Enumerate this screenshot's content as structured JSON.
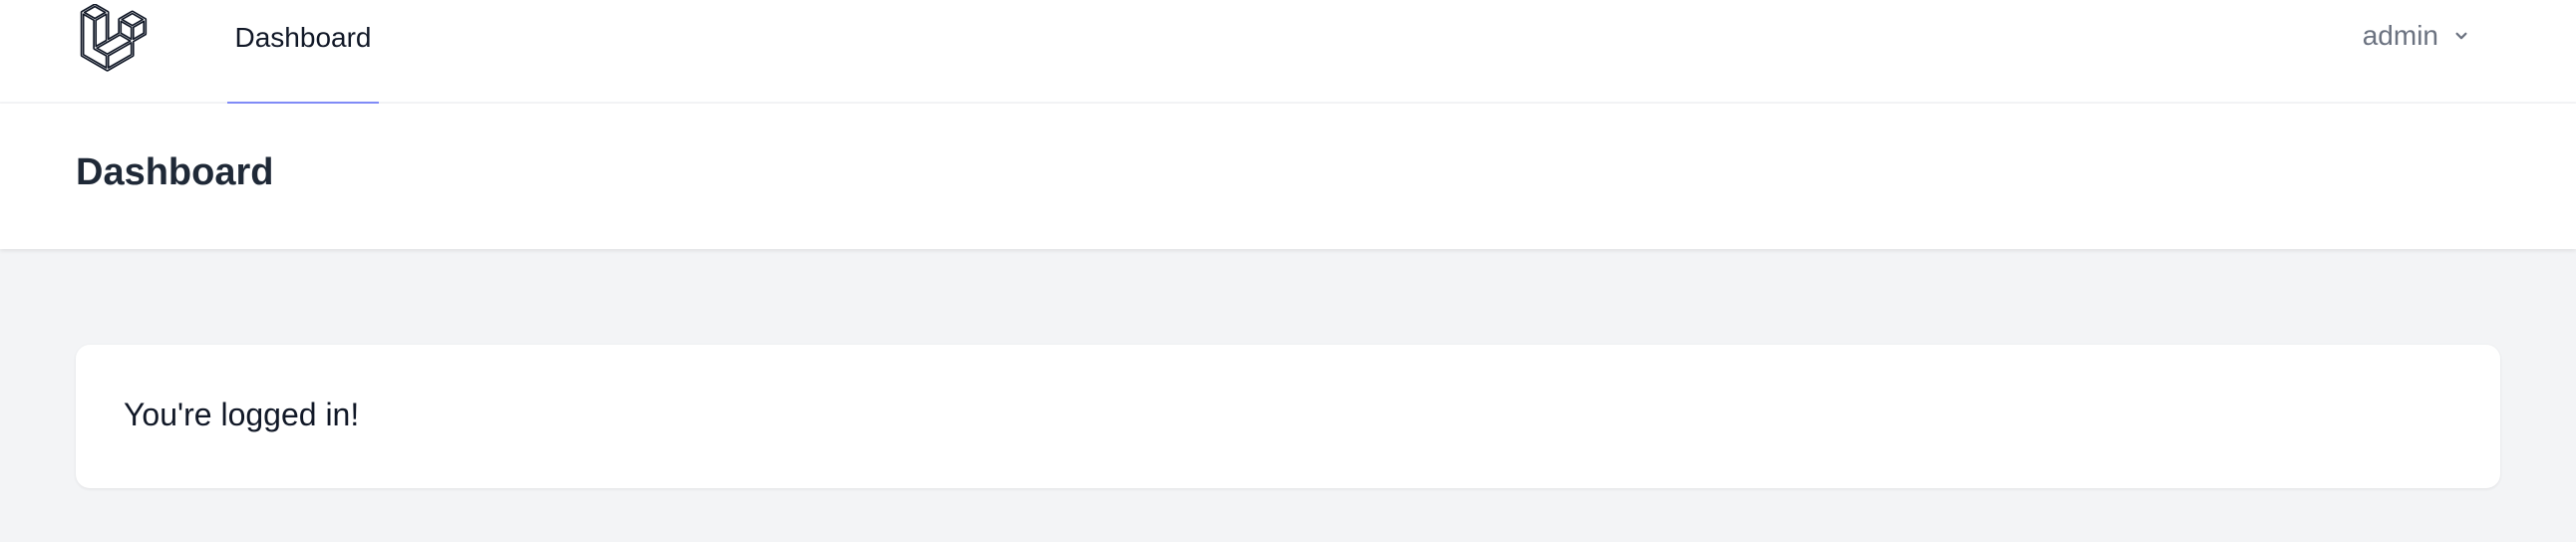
{
  "nav": {
    "logo_icon": "laravel-logo-icon",
    "tabs": [
      {
        "label": "Dashboard",
        "active": true
      }
    ],
    "user_menu": {
      "username": "admin",
      "icon": "chevron-down-icon"
    }
  },
  "header": {
    "title": "Dashboard"
  },
  "main": {
    "card": {
      "message": "You're logged in!"
    }
  },
  "colors": {
    "background": "#f3f4f6",
    "surface": "#ffffff",
    "active_tab_indicator": "#818cf8",
    "muted_text": "#6b7280",
    "heading_text": "#1f2937"
  }
}
